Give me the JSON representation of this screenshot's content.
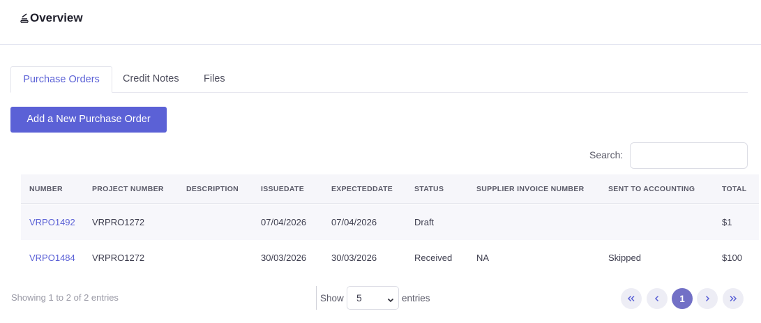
{
  "header": {
    "title": "Overview",
    "icon": "stack-icon"
  },
  "tabs": [
    {
      "label": "Purchase Orders",
      "active": true
    },
    {
      "label": "Credit Notes",
      "active": false
    },
    {
      "label": "Files",
      "active": false
    }
  ],
  "actions": {
    "add_label": "Add a New Purchase Order"
  },
  "search": {
    "label": "Search:",
    "value": ""
  },
  "table": {
    "columns": [
      "NUMBER",
      "PROJECT NUMBER",
      "DESCRIPTION",
      "ISSUEDATE",
      "EXPECTEDDATE",
      "STATUS",
      "SUPPLIER INVOICE NUMBER",
      "SENT TO ACCOUNTING",
      "TOTAL"
    ],
    "rows": [
      {
        "number": "VRPO1492",
        "project": "VRPRO1272",
        "description": "",
        "issue": "07/04/2026",
        "expected": "07/04/2026",
        "status": "Draft",
        "supplier": "",
        "sent": "",
        "total": "$1"
      },
      {
        "number": "VRPO1484",
        "project": "VRPRO1272",
        "description": "",
        "issue": "30/03/2026",
        "expected": "30/03/2026",
        "status": "Received",
        "supplier": "NA",
        "sent": "Skipped",
        "total": "$100"
      }
    ]
  },
  "footer": {
    "info": "Showing 1 to 2 of 2 entries",
    "show_label": "Show",
    "page_size": "5",
    "entries_label": "entries",
    "current_page": "1"
  },
  "colors": {
    "accent": "#5b61d6",
    "active_page": "#7270c6"
  }
}
